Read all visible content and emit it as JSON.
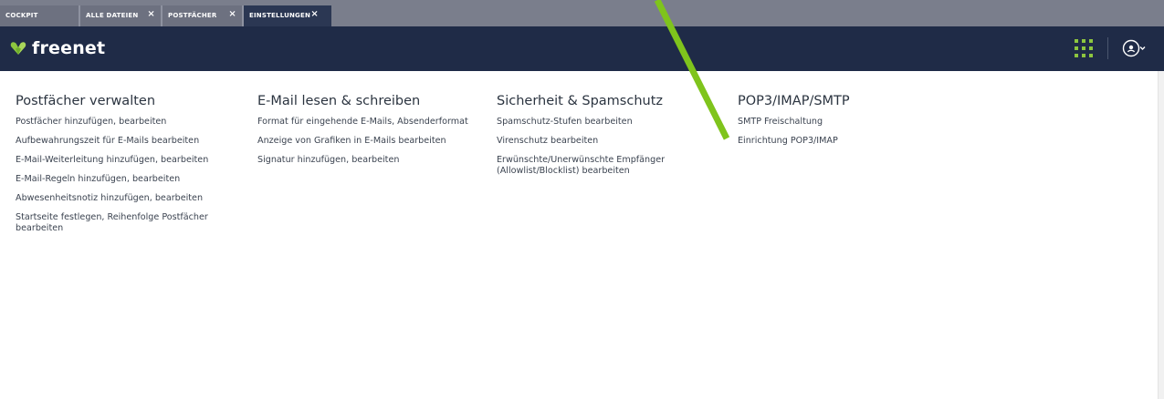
{
  "tabs": [
    {
      "label": "COCKPIT",
      "closable": false,
      "active": false
    },
    {
      "label": "ALLE DATEIEN",
      "closable": true,
      "active": false
    },
    {
      "label": "POSTFÄCHER",
      "closable": true,
      "active": false
    },
    {
      "label": "EINSTELLUNGEN",
      "closable": true,
      "active": true
    }
  ],
  "tab_close_glyph": "×",
  "header": {
    "logo_text": "freenet",
    "logo_icon": "freenet-heart-icon",
    "apps_icon": "apps-grid-icon",
    "avatar_icon": "user-avatar-icon",
    "avatar_menu_icon": "chevron-down-icon"
  },
  "sections": [
    {
      "title": "Postfächer verwalten",
      "links": [
        "Postfächer hinzufügen, bearbeiten",
        "Aufbewahrungszeit für E-Mails bearbeiten",
        "E-Mail-Weiterleitung hinzufügen, bearbeiten",
        "E-Mail-Regeln hinzufügen, bearbeiten",
        "Abwesenheitsnotiz hinzufügen, bearbeiten",
        "Startseite festlegen, Reihenfolge Postfächer bearbeiten"
      ]
    },
    {
      "title": "E-Mail lesen & schreiben",
      "links": [
        "Format für eingehende E-Mails, Absenderformat",
        "Anzeige von Grafiken in E-Mails bearbeiten",
        "Signatur hinzufügen, bearbeiten"
      ]
    },
    {
      "title": "Sicherheit & Spamschutz",
      "links": [
        "Spamschutz-Stufen bearbeiten",
        "Virenschutz bearbeiten",
        "Erwünschte/Unerwünschte Empfänger (Allowlist/Blocklist) bearbeiten"
      ]
    },
    {
      "title": "POP3/IMAP/SMTP",
      "links": [
        "SMTP Freischaltung",
        "Einrichtung POP3/IMAP"
      ]
    }
  ],
  "colors": {
    "header_bg": "#1f2b47",
    "tab_bar_bg": "#7a7e8c",
    "active_tab_bg": "#2b3753",
    "brand_green": "#8dc63f",
    "annotation_arrow": "#7fc41c"
  }
}
